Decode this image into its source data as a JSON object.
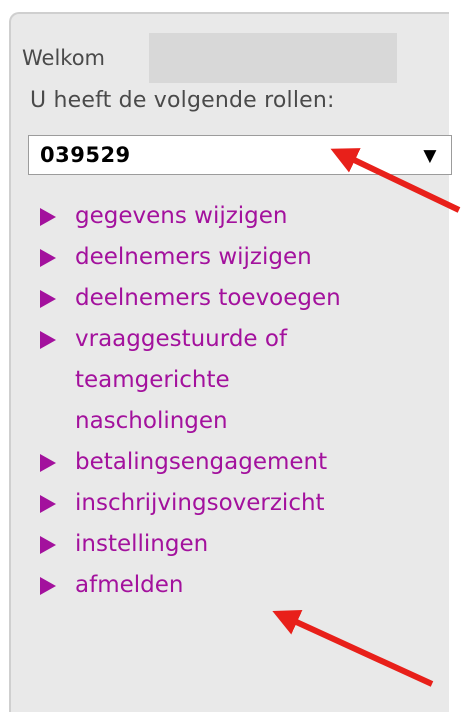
{
  "welcome": {
    "label": "Welkom"
  },
  "roles": {
    "label": "U heeft de volgende rollen:",
    "selected": "039529",
    "caret": "▼"
  },
  "menu": {
    "items": [
      {
        "lines": [
          "gegevens wijzigen"
        ]
      },
      {
        "lines": [
          "deelnemers wijzigen"
        ]
      },
      {
        "lines": [
          "deelnemers toevoegen"
        ]
      },
      {
        "lines": [
          "vraaggestuurde of",
          "teamgerichte",
          "nascholingen"
        ]
      },
      {
        "lines": [
          "betalingsengagement"
        ]
      },
      {
        "lines": [
          "inschrijvingsoverzicht"
        ]
      },
      {
        "lines": [
          "instellingen"
        ]
      },
      {
        "lines": [
          "afmelden"
        ]
      }
    ]
  },
  "colors": {
    "link": "#a3119d",
    "annotation_arrow": "#e8201a",
    "panel_bg": "#e9e9e9"
  }
}
